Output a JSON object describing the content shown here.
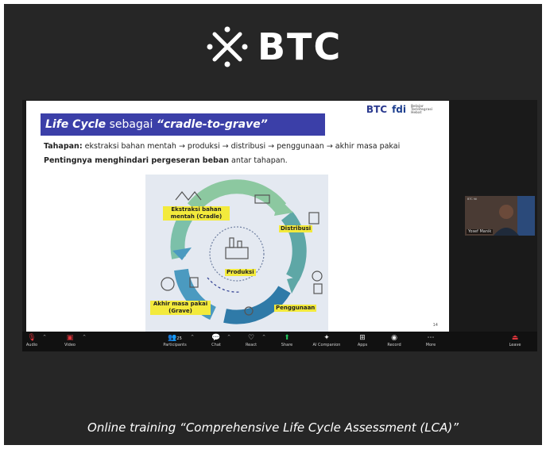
{
  "brand": {
    "name": "BTC"
  },
  "slide": {
    "logo_text": "BTC",
    "logo_fdi": "fdi",
    "logo_small": "Belajar Terintegrasi Hebat",
    "title_italic": "Life Cycle",
    "title_normal": " sebagai ",
    "title_quote": "“cradle-to-grave”",
    "line1_bold": "Tahapan:",
    "line1_text": " ekstraksi bahan mentah → produksi → distribusi → penggunaan → akhir masa pakai",
    "line2_bold": "Pentingnya menghindari pergeseran beban",
    "line2_text": " antar tahapan.",
    "stages": {
      "ekstraksi": "Ekstraksi bahan mentah (Cradle)",
      "distribusi": "Distribusi",
      "produksi": "Produksi",
      "penggunaan": "Penggunaan",
      "akhir": "Akhir masa pakai (Grave)"
    },
    "page_number": "14"
  },
  "participant_video": {
    "name": "Yosef Manik",
    "top_text": "BTC fdi"
  },
  "toolbar": {
    "audio": "Audio",
    "video": "Video",
    "participants": "Participants",
    "participants_count": "25",
    "chat": "Chat",
    "react": "React",
    "share": "Share",
    "ai_companion": "AI Companion",
    "apps": "Apps",
    "record": "Record",
    "more": "More",
    "leave": "Leave"
  },
  "caption": "Online training “Comprehensive Life Cycle Assessment (LCA)”",
  "colors": {
    "frame": "#262626",
    "title_bar": "#3b3fa8",
    "stage_label": "#f3ea3c",
    "share_green": "#23c45e",
    "leave_red": "#e0353b"
  }
}
